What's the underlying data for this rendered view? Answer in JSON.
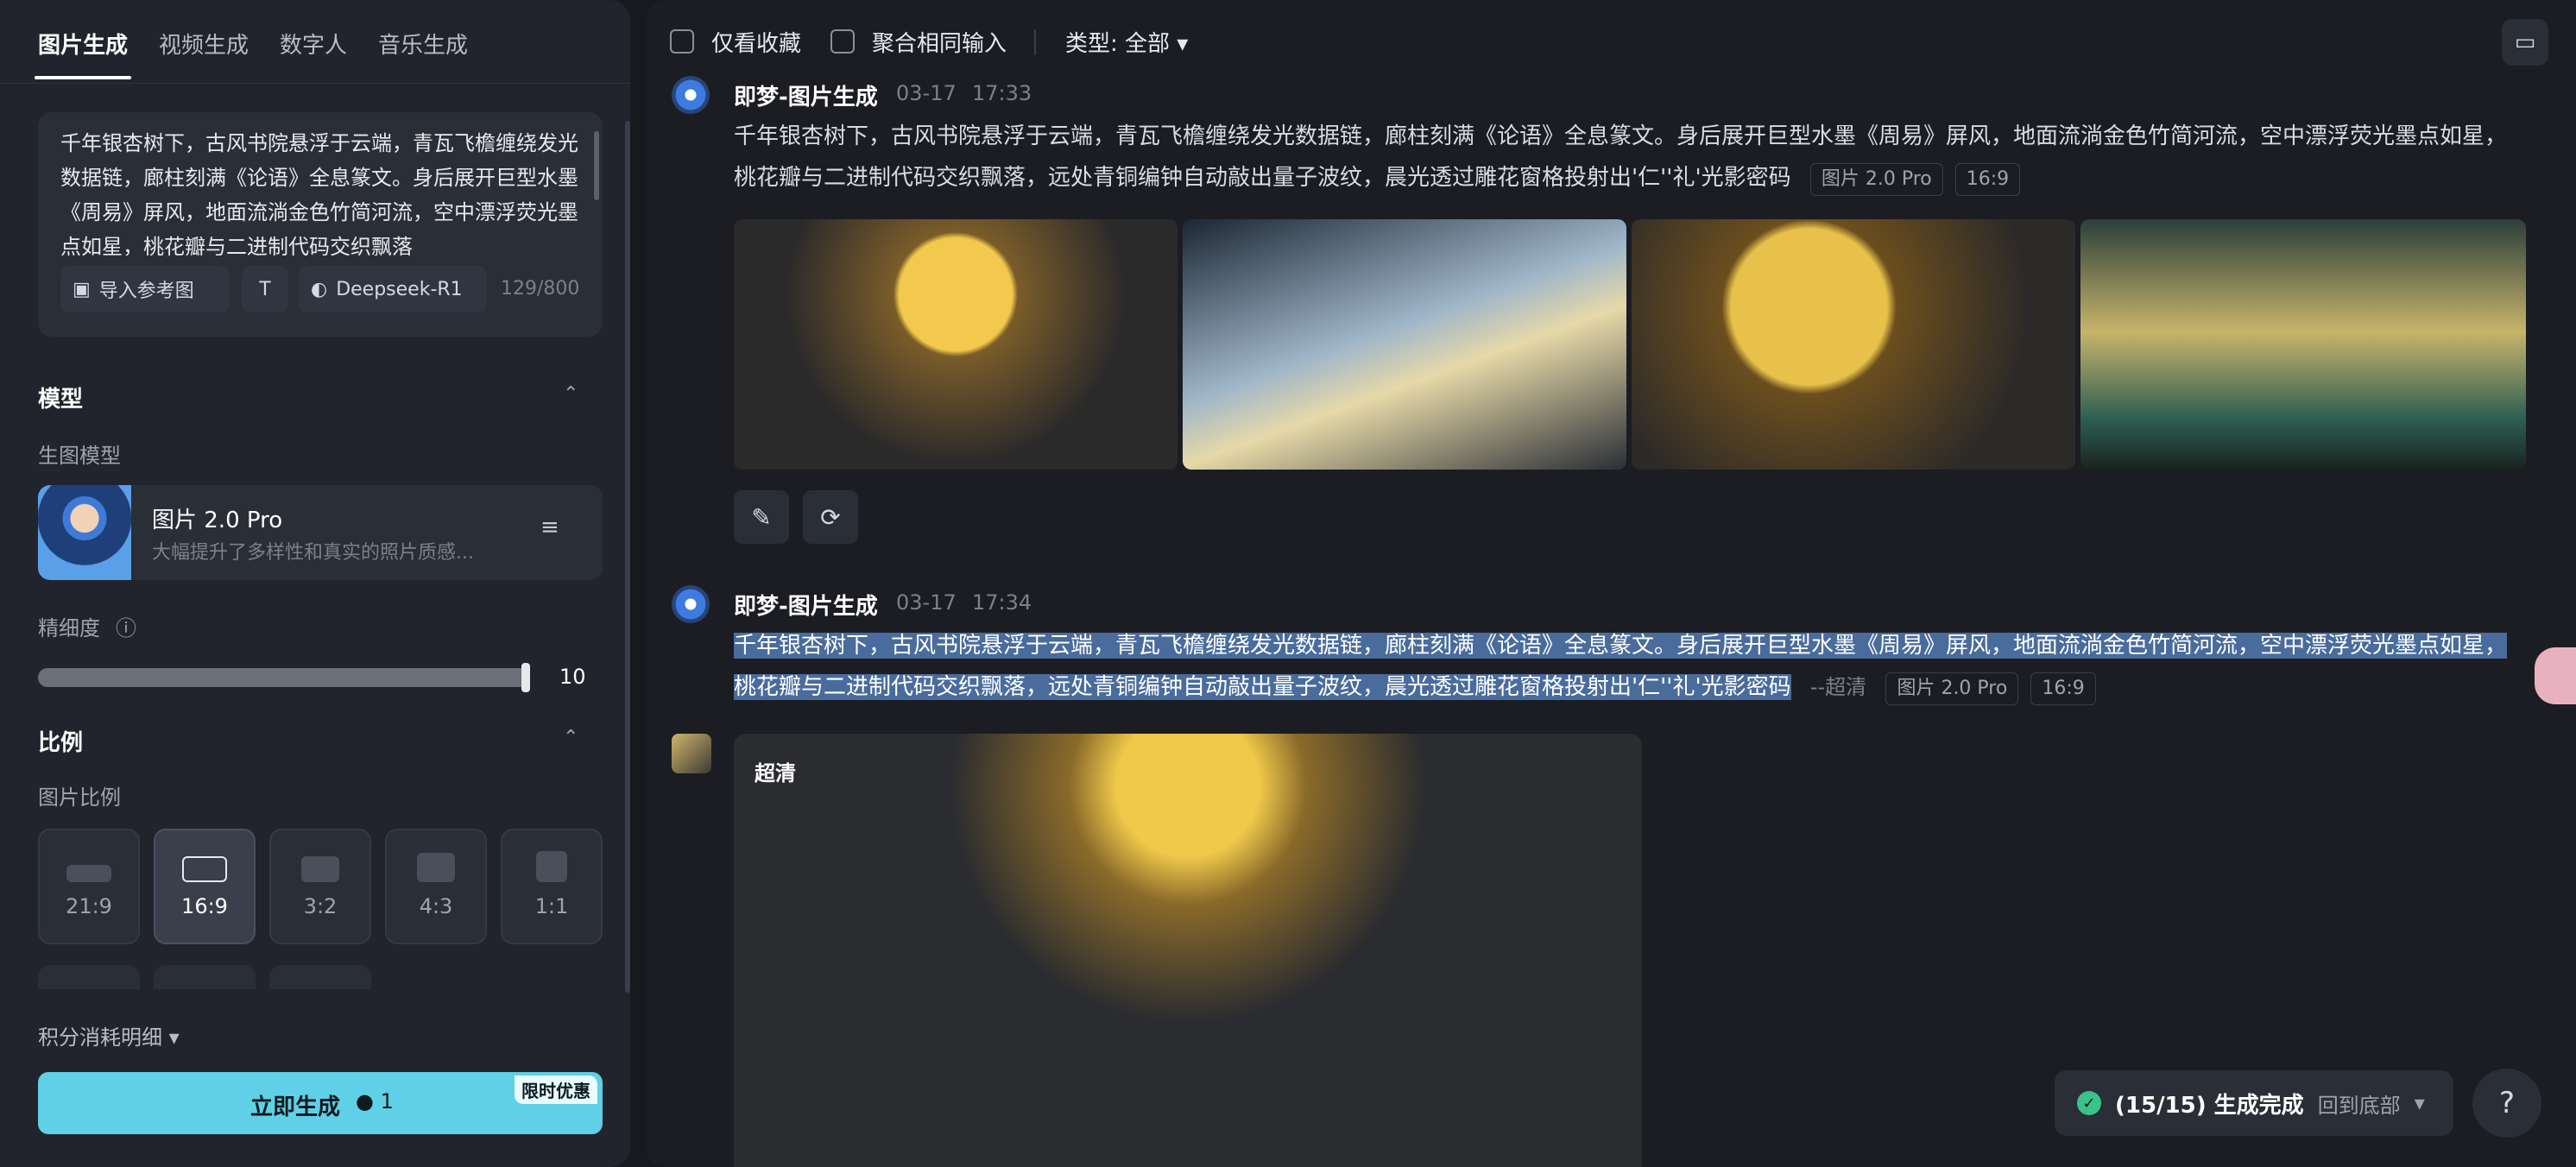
{
  "left_panel": {
    "tabs": [
      {
        "label": "图片生成"
      },
      {
        "label": "视频生成"
      },
      {
        "label": "数字人"
      },
      {
        "label": "音乐生成"
      }
    ],
    "prompt": {
      "text": "千年银杏树下，古风书院悬浮于云端，青瓦飞檐缠绕发光数据链，廊柱刻满《论语》全息篆文。身后展开巨型水墨《周易》屏风，地面流淌金色竹简河流，空中漂浮荧光墨点如星，桃花瓣与二进制代码交织飘落",
      "ref_button": "导入参考图",
      "text_tool": "T",
      "deepseek_label": "Deepseek-R1",
      "char_count": "129/800"
    },
    "model_section": {
      "title": "模型",
      "subtitle": "生图模型",
      "model_name": "图片 2.0 Pro",
      "model_desc": "大幅提升了多样性和真实的照片质感...",
      "precision_label": "精细度",
      "precision_value": "10",
      "precision_level": 1.0
    },
    "ratio_section": {
      "title": "比例",
      "subtitle": "图片比例",
      "options": [
        {
          "label": "21:9"
        },
        {
          "label": "16:9"
        },
        {
          "label": "3:2"
        },
        {
          "label": "4:3"
        },
        {
          "label": "1:1"
        }
      ],
      "selected": "16:9"
    },
    "cost_label": "积分消耗明细",
    "generate": {
      "label": "立即生成",
      "credit": "1",
      "promo": "限时优惠"
    }
  },
  "toolbar": {
    "fav_label": "仅看收藏",
    "merge_label": "聚合相同输入",
    "type_label": "类型: 全部"
  },
  "messages": [
    {
      "sender": "即梦-图片生成",
      "date": "03-17",
      "time": "17:33",
      "body": "千年银杏树下，古风书院悬浮于云端，青瓦飞檐缠绕发光数据链，廊柱刻满《论语》全息篆文。身后展开巨型水墨《周易》屏风，地面流淌金色竹简河流，空中漂浮荧光墨点如星，",
      "body2": "桃花瓣与二进制代码交织飘落，远处青铜编钟自动敲出量子波纹，晨光透过雕花窗格投射出'仁''礼'光影密码",
      "chips": [
        "图片 2.0 Pro",
        "16:9"
      ]
    },
    {
      "sender": "即梦-图片生成",
      "date": "03-17",
      "time": "17:34",
      "body": "千年银杏树下，古风书院悬浮于云端，青瓦飞檐缠绕发光数据链，廊柱刻满《论语》全息篆文。身后展开巨型水墨《周易》屏风，地面流淌金色竹简河流，空中漂浮荧光墨点如星，",
      "body2": "桃花瓣与二进制代码交织飘落，远处青铜编钟自动敲出量子波纹，晨光透过雕花窗格投射出'仁''礼'光影密码",
      "suffix": "--超清",
      "chips": [
        "图片 2.0 Pro",
        "16:9"
      ]
    }
  ],
  "upscale_label": "超清",
  "toast": {
    "text": "(15/15) 生成完成",
    "link": "回到底部"
  },
  "help_label": "?",
  "icons": {
    "check": "✓",
    "chevron": "▾",
    "chevron_up": "⌃",
    "edit": "✎",
    "regen": "⟳",
    "folder": "▭",
    "settings": "≡",
    "info": "ⓘ",
    "image": "▣",
    "whale": "◐"
  }
}
